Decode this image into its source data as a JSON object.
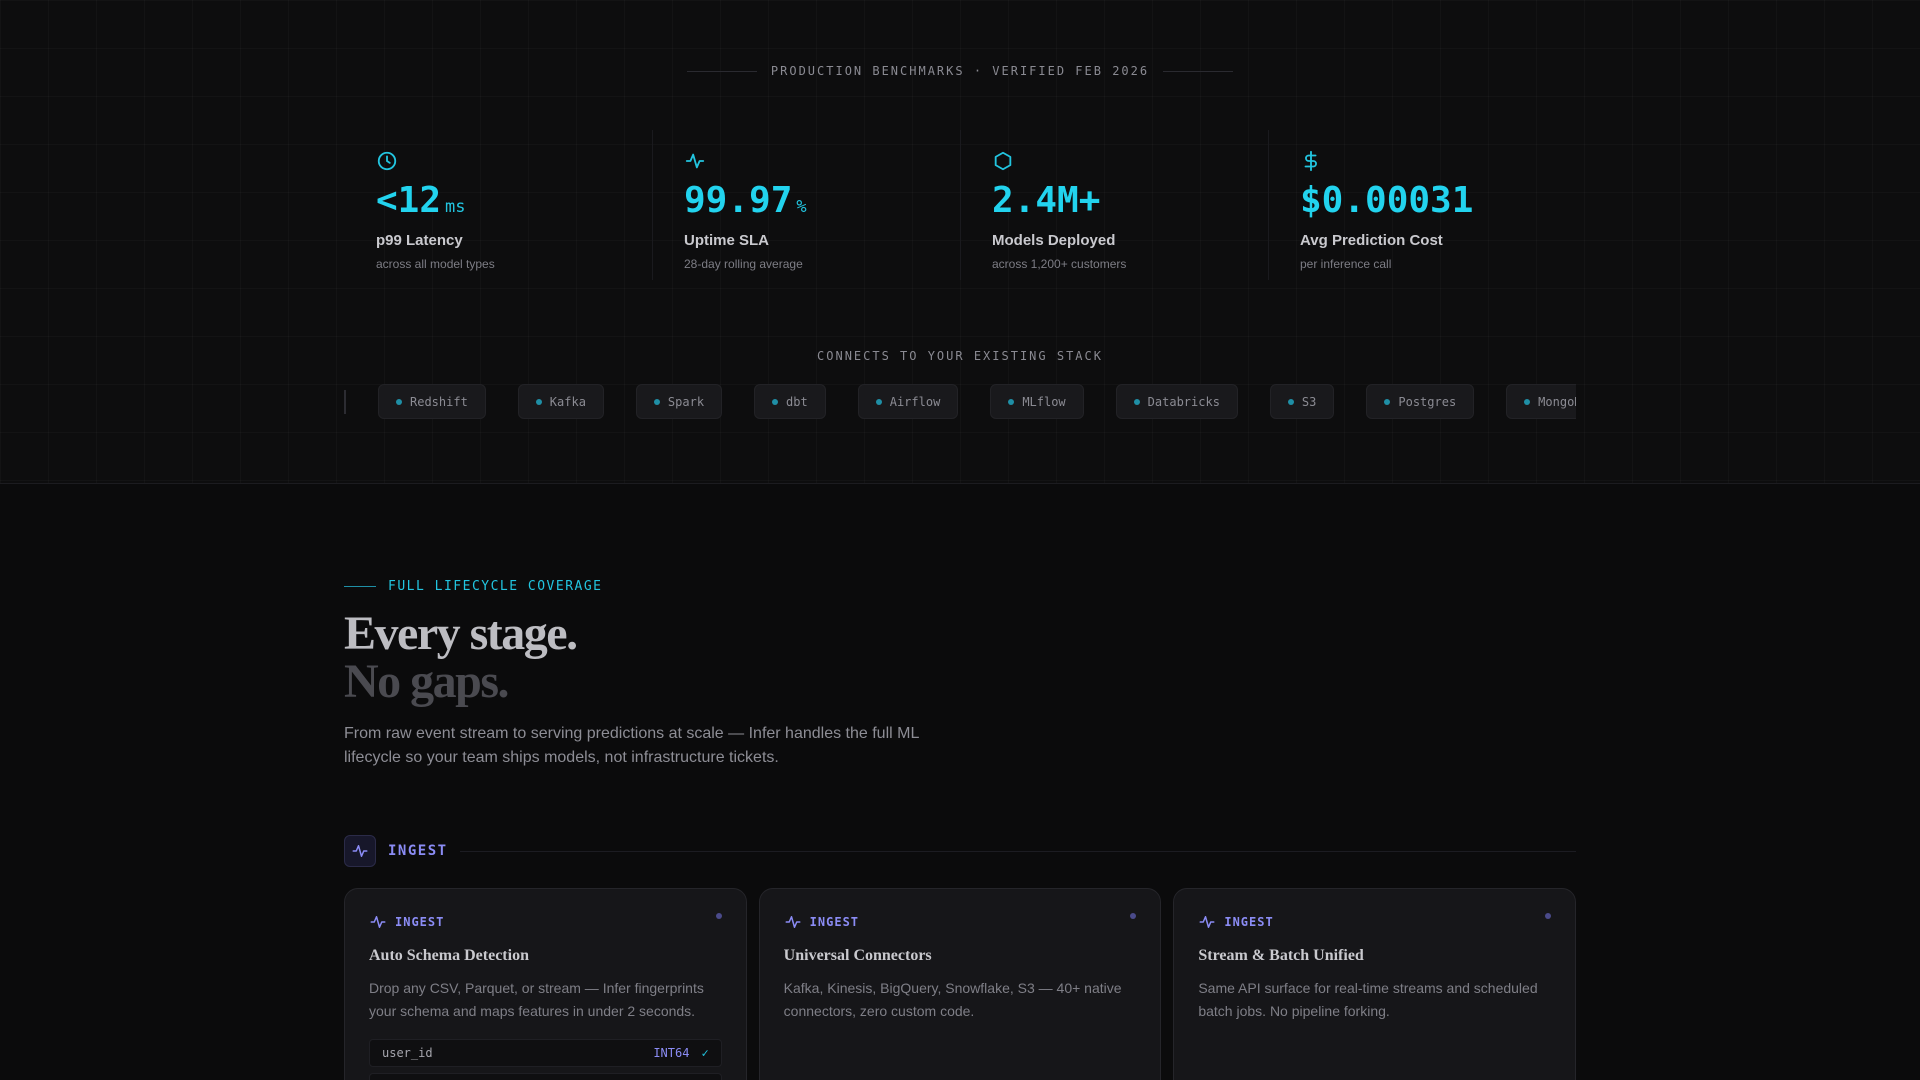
{
  "benchmarks": {
    "header": "PRODUCTION BENCHMARKS · VERIFIED FEB 2026",
    "stats": [
      {
        "icon": "clock-icon",
        "value": "<12",
        "unit": "ms",
        "label": "p99 Latency",
        "sub": "across all model types"
      },
      {
        "icon": "activity-icon",
        "value": "99.97",
        "unit": "%",
        "label": "Uptime SLA",
        "sub": "28-day rolling average"
      },
      {
        "icon": "hexagon-icon",
        "value": "2.4M+",
        "unit": "",
        "label": "Models Deployed",
        "sub": "across 1,200+ customers"
      },
      {
        "icon": "dollar-icon",
        "value": "$0.00031",
        "unit": "",
        "label": "Avg Prediction Cost",
        "sub": "per inference call"
      }
    ]
  },
  "stack": {
    "title": "CONNECTS TO YOUR EXISTING STACK",
    "chips": [
      "Redshift",
      "Kafka",
      "Spark",
      "dbt",
      "Airflow",
      "MLflow",
      "Databricks",
      "S3",
      "Postgres",
      "MongoDB"
    ]
  },
  "lifecycle": {
    "eyebrow": "FULL LIFECYCLE COVERAGE",
    "headline_line1": "Every stage.",
    "headline_line2": "No gaps.",
    "lede": "From raw event stream to serving predictions at scale — Infer handles the full ML lifecycle so your team ships models, not infrastructure tickets."
  },
  "section": {
    "name": "INGEST",
    "icon": "activity-icon",
    "accent": "#8b8cf5"
  },
  "cards": [
    {
      "tag": "INGEST",
      "title": "Auto Schema Detection",
      "desc": "Drop any CSV, Parquet, or stream — Infer fingerprints your schema and maps features in under 2 seconds.",
      "schema": [
        {
          "field": "user_id",
          "type": "INT64",
          "status": "✓"
        }
      ]
    },
    {
      "tag": "INGEST",
      "title": "Universal Connectors",
      "desc": "Kafka, Kinesis, BigQuery, Snowflake, S3 — 40+ native connectors, zero custom code."
    },
    {
      "tag": "INGEST",
      "title": "Stream & Batch Unified",
      "desc": "Same API surface for real-time streams and scheduled batch jobs. No pipeline forking."
    }
  ],
  "colors": {
    "cyan": "#22d3ee",
    "indigo": "#8b8cf5",
    "background": "#0b0b0c"
  }
}
